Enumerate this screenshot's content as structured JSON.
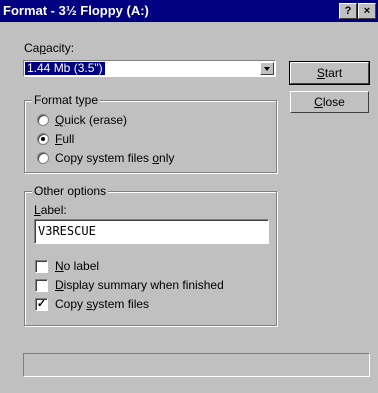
{
  "window": {
    "title": "Format - 3½ Floppy (A:)",
    "help_button": "?",
    "close_button": "×"
  },
  "capacity": {
    "label_pre": "Ca",
    "label_ul": "p",
    "label_post": "acity:",
    "selected": "1.44 Mb (3.5\")"
  },
  "buttons": {
    "start": {
      "ul": "S",
      "rest": "tart"
    },
    "close": {
      "ul": "C",
      "rest": "lose"
    }
  },
  "format_type": {
    "title": "Format type",
    "quick": {
      "ul": "Q",
      "rest": "uick (erase)",
      "checked": false
    },
    "full": {
      "ul": "F",
      "rest": "ull",
      "checked": true
    },
    "copy_only": {
      "pre": "Copy system files ",
      "ul": "o",
      "rest": "nly",
      "checked": false
    }
  },
  "other_options": {
    "title": "Other options",
    "label_caption": {
      "ul": "L",
      "rest": "abel:"
    },
    "label_value": "V3RESCUE",
    "no_label": {
      "ul": "N",
      "rest": "o label",
      "checked": false
    },
    "display_summary": {
      "ul": "D",
      "rest": "isplay summary when finished",
      "checked": false
    },
    "copy_system_files": {
      "pre": "Copy ",
      "ul": "s",
      "rest": "ystem files",
      "checked": true,
      "mark": "✓"
    }
  }
}
